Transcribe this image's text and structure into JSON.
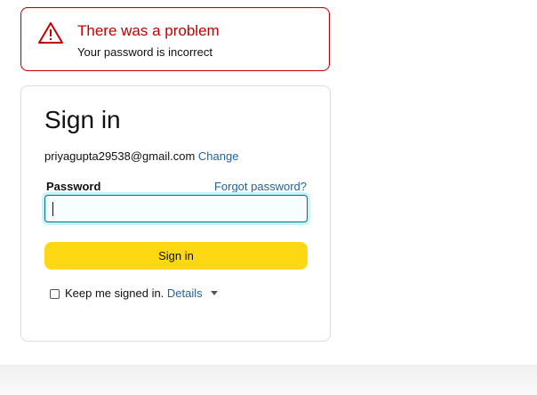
{
  "alert": {
    "title": "There was a problem",
    "message": "Your password is incorrect",
    "icon": "warning-triangle-icon",
    "color": "#c40000"
  },
  "signin": {
    "heading": "Sign in",
    "email": "priyagupta29538@gmail.com",
    "change_label": "Change",
    "password_label": "Password",
    "forgot_label": "Forgot password?",
    "password_value": "",
    "button_label": "Sign in",
    "button_color": "#ffd814",
    "keep_signed_in_label": "Keep me signed in.",
    "keep_signed_in_checked": false,
    "details_label": "Details"
  },
  "colors": {
    "link": "#2162a1",
    "input_focus": "#007185"
  }
}
